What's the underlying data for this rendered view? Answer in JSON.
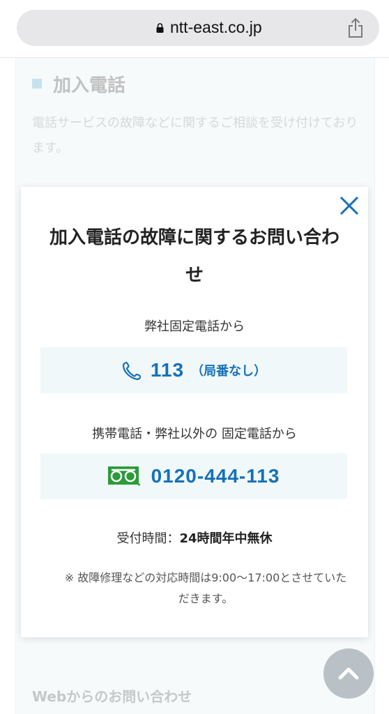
{
  "browser": {
    "url": "ntt-east.co.jp"
  },
  "section": {
    "title": "加入電話",
    "description": "電話サービスの故障などに関するご相談を受け付けております。"
  },
  "modal": {
    "title": "加入電話の故障に関するお問い合わせ",
    "own_line_label": "弊社固定電話から",
    "own_line_number": "113",
    "own_line_note": "（局番なし）",
    "other_line_label": "携帯電話・弊社以外の 固定電話から",
    "other_line_number": "0120-444-113",
    "hours_label": "受付時間：",
    "hours_value": "24時間年中無休",
    "footnote": "※ 故障修理などの対応時間は9:00〜17:00とさせていただきます。"
  },
  "footer": {
    "web_contact": "Webからのお問い合わせ"
  },
  "colors": {
    "accent": "#1670b8",
    "freedial_green": "#2a9b3a"
  }
}
